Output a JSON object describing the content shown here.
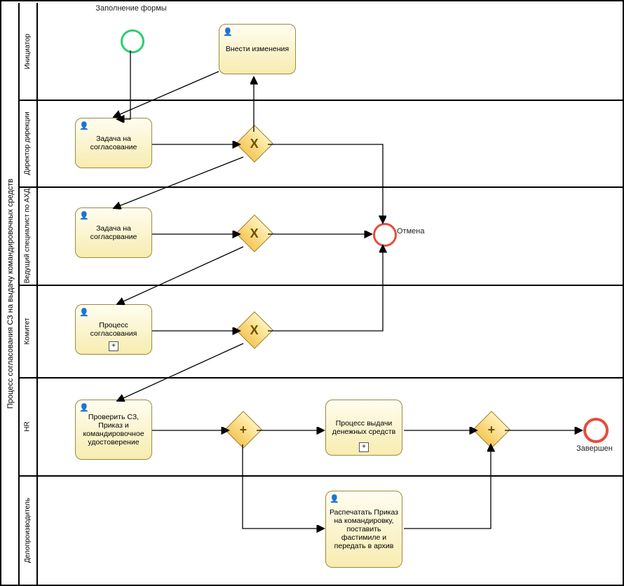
{
  "pool": {
    "title": "Процесс согласования СЗ на выдачу командировочных средств"
  },
  "lanes": {
    "l1": {
      "title": "Инициатор"
    },
    "l2": {
      "title": "Директор дирекции"
    },
    "l3": {
      "title": "Ведущий специалист по АХД"
    },
    "l4": {
      "title": "Комитет"
    },
    "l5": {
      "title": "HR"
    },
    "l6": {
      "title": "Делопроизводитель"
    }
  },
  "nodes": {
    "start_label": "Заполнение формы",
    "t_changes": "Внести изменения",
    "t_dir": "Задача на согласование",
    "t_ahd": "Задача на согласрвание",
    "t_kom": "Процесс согласования",
    "t_hr": "Проверить СЗ, Приказ и командировочное удостоверение",
    "t_cash": "Процесс выдачи денежных средств",
    "t_print": "Распечатать Приказ на командировку, поставить фастимиле и передать в архив",
    "cancel": "Отмена",
    "done": "Завершен"
  },
  "gates": {
    "x": "X",
    "p": "+"
  },
  "icons": {
    "user": "👤",
    "sub": "+"
  }
}
